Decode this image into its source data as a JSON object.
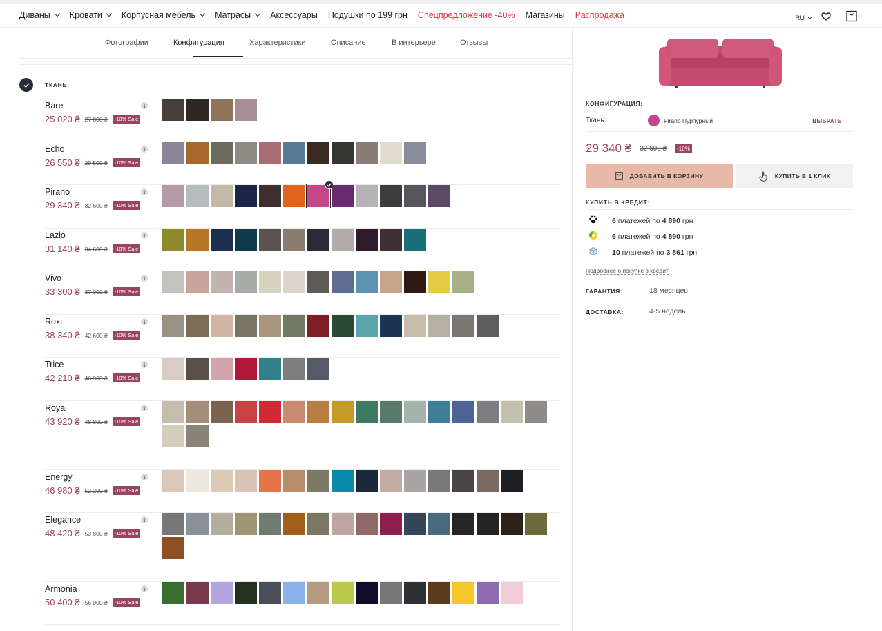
{
  "nav": {
    "items": [
      {
        "label": "Диваны",
        "dropdown": true,
        "red": false
      },
      {
        "label": "Кровати",
        "dropdown": true,
        "red": false
      },
      {
        "label": "Корпусная мебель",
        "dropdown": true,
        "red": false
      },
      {
        "label": "Матрасы",
        "dropdown": true,
        "red": false
      },
      {
        "label": "Аксессуары",
        "dropdown": false,
        "red": false
      },
      {
        "label": "Подушки по 199 грн",
        "dropdown": false,
        "red": false
      },
      {
        "label": "Спецпредложение -40%",
        "dropdown": false,
        "red": true
      },
      {
        "label": "Магазины",
        "dropdown": false,
        "red": false
      },
      {
        "label": "Распродажа",
        "dropdown": false,
        "red": true
      }
    ],
    "lang": "RU"
  },
  "tabs": [
    "Фотографии",
    "Конфигурация",
    "Характеристики",
    "Описание",
    "В интерьере",
    "Отзывы"
  ],
  "active_tab": "Конфигурация",
  "step": {
    "title": "ТКАНЬ:"
  },
  "fabrics": [
    {
      "name": "Bare",
      "price": "25 020 ₴",
      "old_price": "27 800 ₴",
      "sale": "-10% Sale",
      "swatches": [
        "#45403a",
        "#2e2724",
        "#8f7558",
        "#a58e94"
      ]
    },
    {
      "name": "Echo",
      "price": "26 550 ₴",
      "old_price": "29 500 ₴",
      "sale": "-10% Sale",
      "swatches": [
        "#8a8698",
        "#a86a2c",
        "#6b6a5c",
        "#8e8d84",
        "#a86e74",
        "#597a96",
        "#3a2a22",
        "#363634",
        "#8a7c74",
        "#e2dcd0",
        "#8a8c9c"
      ]
    },
    {
      "name": "Pirano",
      "price": "29 340 ₴",
      "old_price": "32 600 ₴",
      "sale": "-10% Sale",
      "selected": 6,
      "swatches": [
        "#b49aa6",
        "#b4bcbe",
        "#c4b8a8",
        "#1c2448",
        "#3e302e",
        "#e2641c",
        "#c2488a",
        "#6a2a6e",
        "#b4b4b6",
        "#3c3c3c",
        "#56565c",
        "#5c4a64"
      ]
    },
    {
      "name": "Lazio",
      "price": "31 140 ₴",
      "old_price": "34 600 ₴",
      "sale": "-10% Sale",
      "swatches": [
        "#8c8a2c",
        "#b87624",
        "#1e2e4e",
        "#0e3a4c",
        "#5e5250",
        "#8c7c70",
        "#2a2a38",
        "#b4aca8",
        "#301a2e",
        "#3e3030",
        "#1a6e7a"
      ]
    },
    {
      "name": "Vivo",
      "price": "33 300 ₴",
      "old_price": "37 000 ₴",
      "sale": "-10% Sale",
      "swatches": [
        "#c2c2c0",
        "#c8a49a",
        "#c4b4b0",
        "#a8aaa4",
        "#d8d2c0",
        "#dcd4cc",
        "#5e5a54",
        "#5e6e92",
        "#5a94b0",
        "#c8a48a",
        "#2e1a12",
        "#e2cc48",
        "#a8b08a"
      ]
    },
    {
      "name": "Roxi",
      "price": "38 340 ₴",
      "old_price": "42 600 ₴",
      "sale": "-10% Sale",
      "swatches": [
        "#9a9284",
        "#7a6e56",
        "#d2b4a4",
        "#7a7464",
        "#a8967e",
        "#6e7a64",
        "#7e1e24",
        "#2a4a36",
        "#5aa4ac",
        "#1e3454",
        "#c8bcac",
        "#b4b0a4",
        "#7a7870",
        "#5e5e5e"
      ]
    },
    {
      "name": "Trice",
      "price": "42 210 ₴",
      "old_price": "46 900 ₴",
      "sale": "-10% Sale",
      "swatches": [
        "#d8ccc4",
        "#5a5048",
        "#d4a4ac",
        "#b0183a",
        "#30808e",
        "#7e7e7e",
        "#545a66"
      ]
    },
    {
      "name": "Royal",
      "price": "43 920 ₴",
      "old_price": "48 800 ₴",
      "sale": "-10% Sale",
      "swatches": [
        "#c4bcac",
        "#a48e7a",
        "#7a6450",
        "#c84444",
        "#d22a34",
        "#c88a70",
        "#b87c44",
        "#c49a2a",
        "#3e7a62",
        "#587a6a",
        "#a4b4ac",
        "#3e7e98",
        "#4e6496",
        "#7e7e80",
        "#c4c0b0",
        "#8e8c88",
        "#d4ccbc",
        "#8a8478"
      ]
    },
    {
      "name": "Energy",
      "price": "46 980 ₴",
      "old_price": "52 200 ₴",
      "sale": "-10% Sale",
      "swatches": [
        "#dcc8b8",
        "#ece8de",
        "#dccab4",
        "#d8c4b4",
        "#e67448",
        "#b88e6a",
        "#7a7a66",
        "#0a8aaa",
        "#1a2a3a",
        "#c4aca4",
        "#aaa4a2",
        "#7a7878",
        "#4a4448",
        "#7a6a62",
        "#1e1e24"
      ]
    },
    {
      "name": "Elegance",
      "price": "48 420 ₴",
      "old_price": "53 800 ₴",
      "sale": "-10% Sale",
      "swatches": [
        "#767876",
        "#8a9298",
        "#b4ae9e",
        "#9e9476",
        "#6e7c74",
        "#a0601c",
        "#7e7664",
        "#c0a4a2",
        "#8e6a6a",
        "#8e1e4a",
        "#344658",
        "#4a6a80",
        "#262626",
        "#242424",
        "#2e2218",
        "#6a6a3a",
        "#8e5026"
      ]
    },
    {
      "name": "Armonia",
      "price": "50 400 ₴",
      "old_price": "56 000 ₴",
      "sale": "-10% Sale",
      "swatches": [
        "#3a6e2e",
        "#7a3a4e",
        "#b4a4dc",
        "#22321e",
        "#4a4e58",
        "#8ab2ea",
        "#b49a7e",
        "#bcca4a",
        "#0e0e2a",
        "#767674",
        "#2e3236",
        "#5a3a1a",
        "#f4c628",
        "#8e6ab0",
        "#f2ccd6"
      ]
    }
  ],
  "config": {
    "title": "КОНФИГУРАЦИЯ:",
    "fabric_label": "Ткань:",
    "fabric_value": "Pirano Пурпурный",
    "fabric_color": "#c2488a",
    "choose_label": "ВЫБРАТЬ"
  },
  "summary": {
    "price": "29 340 ₴",
    "old_price": "32 600 ₴",
    "discount": "-10%",
    "cart_button": "ДОБАВИТЬ В КОРЗИНУ",
    "oneclick_button": "КУПИТЬ В 1 КЛИК"
  },
  "credit": {
    "title": "КУПИТЬ В КРЕДИТ:",
    "items": [
      {
        "count": "6",
        "text": "платежей по",
        "amount": "4 890",
        "currency": "грн",
        "icon": "paw-icon"
      },
      {
        "count": "6",
        "text": "платежей по",
        "amount": "4 890",
        "currency": "грн",
        "icon": "bank-icon"
      },
      {
        "count": "10",
        "text": "платежей по",
        "amount": "3 861",
        "currency": "грн",
        "icon": "cube-icon"
      }
    ],
    "more": "Подробнее о покупке в кредит"
  },
  "meta": {
    "warranty_label": "ГАРАНТИЯ:",
    "warranty_value": "18 месяцев",
    "delivery_label": "ДОСТАВКА:",
    "delivery_value": "4-5 недель"
  },
  "colors": {
    "accent": "#9b4461",
    "cart_button": "#e8b8a8",
    "dark": "#262c39"
  }
}
